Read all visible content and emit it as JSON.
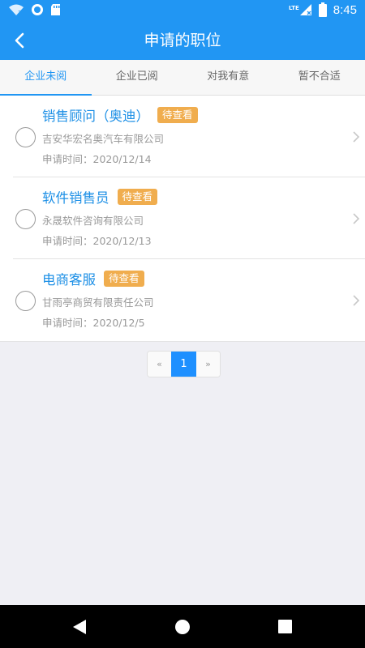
{
  "status_bar": {
    "time": "8:45",
    "network": "LTE",
    "icons": [
      "wifi-question-icon",
      "sync-icon",
      "sd-card-icon",
      "signal-icon",
      "battery-icon"
    ]
  },
  "app_bar": {
    "title": "申请的职位",
    "back_icon": "chevron-left-icon"
  },
  "tabs": [
    {
      "label": "企业未阅",
      "active": true
    },
    {
      "label": "企业已阅",
      "active": false
    },
    {
      "label": "对我有意",
      "active": false
    },
    {
      "label": "暂不合适",
      "active": false
    }
  ],
  "applications": [
    {
      "title": "销售顾问（奥迪）",
      "status": "待查看",
      "company": "吉安华宏名奥汽车有限公司",
      "date": "申请时间：2020/12/14"
    },
    {
      "title": "软件销售员",
      "status": "待查看",
      "company": "永晟软件咨询有限公司",
      "date": "申请时间：2020/12/13"
    },
    {
      "title": "电商客服",
      "status": "待查看",
      "company": "甘雨亭商贸有限责任公司",
      "date": "申请时间：2020/12/5"
    }
  ],
  "pagination": {
    "prev": "«",
    "current": "1",
    "next": "»"
  },
  "colors": {
    "primary": "#2196f3",
    "badge": "#f0ad4e",
    "title_text": "#1e90e6",
    "background": "#efeff4"
  },
  "nav_bar": {
    "icons": [
      "back-triangle-icon",
      "home-circle-icon",
      "recents-square-icon"
    ]
  }
}
